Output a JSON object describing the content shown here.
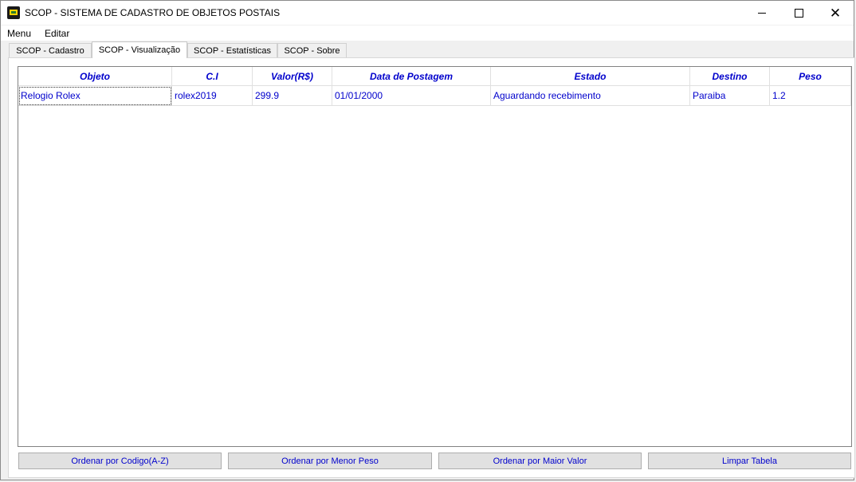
{
  "window": {
    "title": "SCOP - SISTEMA DE CADASTRO DE OBJETOS POSTAIS"
  },
  "menubar": {
    "items": [
      "Menu",
      "Editar"
    ]
  },
  "tabs": [
    {
      "label": "SCOP - Cadastro",
      "active": false
    },
    {
      "label": "SCOP - Visualização",
      "active": true
    },
    {
      "label": "SCOP - Estatísticas",
      "active": false
    },
    {
      "label": "SCOP - Sobre",
      "active": false
    }
  ],
  "table": {
    "columns": [
      "Objeto",
      "C.I",
      "Valor(R$)",
      "Data de Postagem",
      "Estado",
      "Destino",
      "Peso"
    ],
    "rows": [
      [
        "Relogio Rolex",
        "rolex2019",
        "299.9",
        "01/01/2000",
        "Aguardando recebimento",
        "Paraiba",
        "1.2"
      ]
    ]
  },
  "buttons": {
    "sort_code": "Ordenar por Codigo(A-Z)",
    "sort_weight": "Ordenar por Menor Peso",
    "sort_value": "Ordenar por Maior Valor",
    "clear_table": "Limpar Tabela"
  },
  "colors": {
    "accent_text": "#0000cc",
    "button_bg": "#e1e1e1"
  },
  "icons": {
    "app": "scop-app-icon",
    "minimize": "minimize-icon",
    "maximize": "maximize-icon",
    "close": "close-icon"
  }
}
